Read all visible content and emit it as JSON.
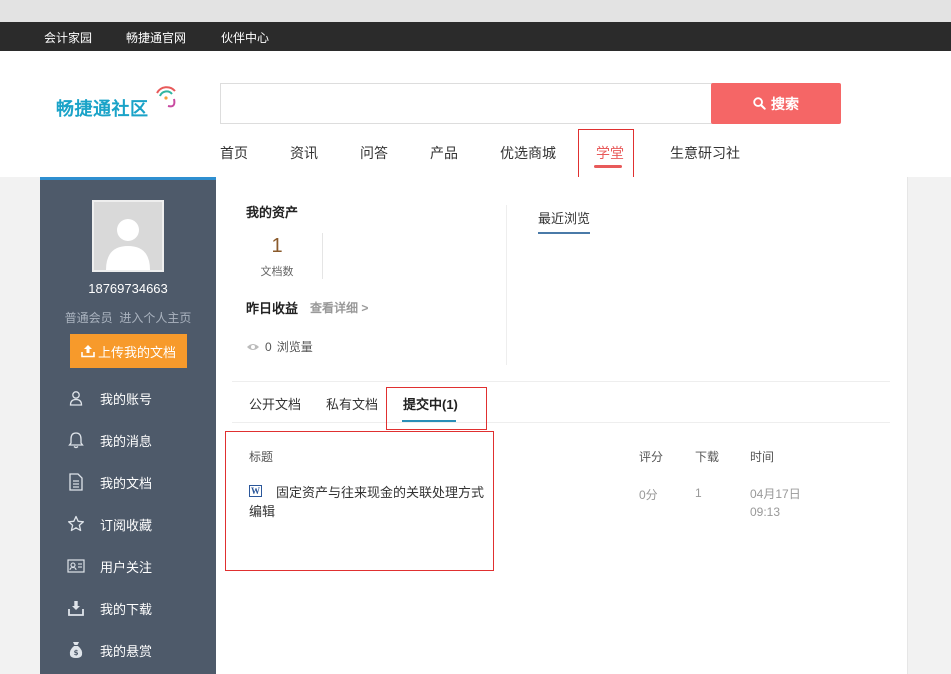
{
  "topbar": {
    "links": [
      "会计家园",
      "畅捷通官网",
      "伙伴中心"
    ]
  },
  "logo": {
    "text": "畅捷通社区"
  },
  "search": {
    "placeholder": "",
    "button_label": "搜索"
  },
  "nav": {
    "items": [
      "首页",
      "资讯",
      "问答",
      "产品",
      "优选商城",
      "学堂",
      "生意研习社"
    ],
    "active": "学堂"
  },
  "sidebar": {
    "username": "18769734663",
    "member_level": "普通会员",
    "home_link": "进入个人主页",
    "upload_label": "上传我的文档",
    "items": [
      {
        "label": "我的账号",
        "icon": "user-icon"
      },
      {
        "label": "我的消息",
        "icon": "bell-icon"
      },
      {
        "label": "我的文档",
        "icon": "document-icon"
      },
      {
        "label": "订阅收藏",
        "icon": "star-icon"
      },
      {
        "label": "用户关注",
        "icon": "id-card-icon"
      },
      {
        "label": "我的下载",
        "icon": "download-icon"
      },
      {
        "label": "我的悬赏",
        "icon": "money-bag-icon"
      }
    ]
  },
  "assets": {
    "title": "我的资产",
    "doc_count": "1",
    "doc_count_label": "文档数",
    "yesterday_label": "昨日收益",
    "view_detail": "查看详细 >",
    "views_count": "0",
    "views_label": "浏览量"
  },
  "recent": {
    "title": "最近浏览"
  },
  "tabs": {
    "items": [
      "公开文档",
      "私有文档",
      "提交中(1)"
    ],
    "active": "提交中(1)"
  },
  "table": {
    "headers": {
      "title": "标题",
      "score": "评分",
      "downloads": "下载",
      "time": "时间"
    },
    "rows": [
      {
        "icon_letter": "W",
        "title": "固定资产与往来现金的关联处理方式编辑",
        "score": "0分",
        "downloads": "1",
        "date": "04月17日",
        "clock": "09:13"
      }
    ]
  },
  "colors": {
    "accent_red": "#f56666",
    "sidebar_bg": "#4e5a6a",
    "upload_orange": "#f79a2b",
    "logo_blue": "#1aa3c8"
  }
}
